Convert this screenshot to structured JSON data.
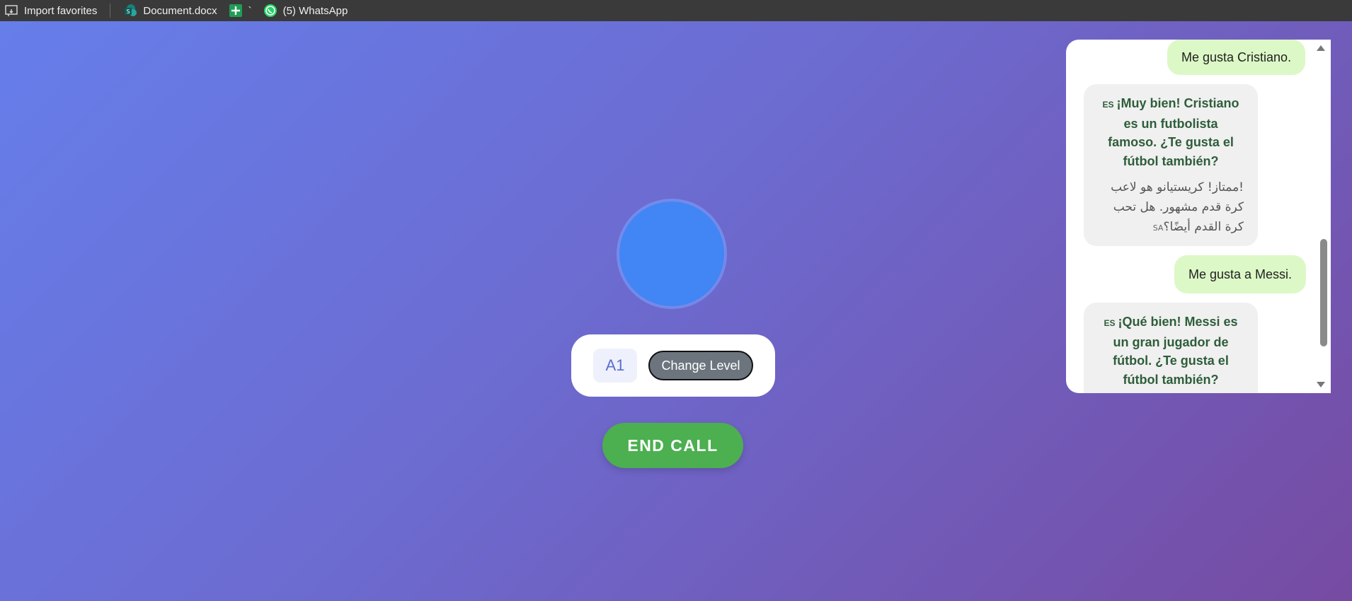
{
  "bookmarks": [
    {
      "label": "Import favorites",
      "icon": "import-icon"
    },
    {
      "label": "Document.docx",
      "icon": "sharepoint-icon"
    },
    {
      "label": "`",
      "icon": "sheets-plus-icon"
    },
    {
      "label": "(5) WhatsApp",
      "icon": "whatsapp-icon"
    }
  ],
  "level": {
    "badge": "A1",
    "change_label": "Change Level"
  },
  "end_call_label": "END CALL",
  "chat": {
    "messages": [
      {
        "role": "user",
        "text": "Me gusta Cristiano."
      },
      {
        "role": "bot",
        "es_tag": "ES",
        "es_text": "¡Muy bien! Cristiano es un futbolista famoso. ¿Te gusta el fútbol también?",
        "ar_tag": "SA",
        "ar_text": "!ممتاز! كريستيانو هو لاعب كرة قدم مشهور. هل تحب كرة القدم أيضًا؟"
      },
      {
        "role": "user",
        "text": "Me gusta a Messi."
      },
      {
        "role": "bot",
        "es_tag": "ES",
        "es_text": "¡Qué bien! Messi es un gran jugador de fútbol. ¿Te gusta el fútbol también?"
      }
    ]
  },
  "colors": {
    "accent_green": "#4caf50",
    "user_bubble": "#dcf8c6",
    "avatar_blue": "#4285f4"
  }
}
